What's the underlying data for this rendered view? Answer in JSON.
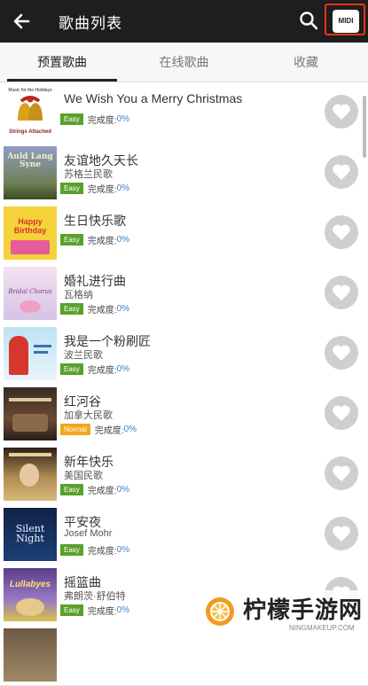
{
  "app_bar": {
    "title": "歌曲列表",
    "midi_label": "MIDI",
    "highlight_color": "#e8341c"
  },
  "tabs": [
    {
      "label": "预置歌曲",
      "active": true
    },
    {
      "label": "在线歌曲",
      "active": false
    },
    {
      "label": "收藏",
      "active": false
    }
  ],
  "songs": [
    {
      "title": "We Wish You a Merry Christmas",
      "artist": "",
      "level": "Easy",
      "done_label": "完成度:",
      "done_value": "0%",
      "cover_header": "Music for the Holidays",
      "cover_caption": "Strings Attached"
    },
    {
      "title": "友谊地久天长",
      "artist": "苏格兰民歌",
      "level": "Easy",
      "done_label": "完成度:",
      "done_value": "0%",
      "cover_header": "",
      "cover_caption": "Auld Lang Syne"
    },
    {
      "title": "生日快乐歌",
      "artist": "",
      "level": "Easy",
      "done_label": "完成度:",
      "done_value": "0%",
      "cover_header": "",
      "cover_caption": "Happy Birthday"
    },
    {
      "title": "婚礼进行曲",
      "artist": "瓦格纳",
      "level": "Easy",
      "done_label": "完成度:",
      "done_value": "0%",
      "cover_header": "",
      "cover_caption": "Bridal Chorus"
    },
    {
      "title": "我是一个粉刷匠",
      "artist": "波兰民歌",
      "level": "Easy",
      "done_label": "完成度:",
      "done_value": "0%",
      "cover_header": "",
      "cover_caption": ""
    },
    {
      "title": "红河谷",
      "artist": "加拿大民歌",
      "level": "Normal",
      "done_label": "完成度:",
      "done_value": "0%",
      "cover_header": "",
      "cover_caption": ""
    },
    {
      "title": "新年快乐",
      "artist": "美国民歌",
      "level": "Easy",
      "done_label": "完成度:",
      "done_value": "0%",
      "cover_header": "",
      "cover_caption": ""
    },
    {
      "title": "平安夜",
      "artist": "Josef Mohr",
      "level": "Easy",
      "done_label": "完成度:",
      "done_value": "0%",
      "cover_header": "",
      "cover_caption": "Silent Night"
    },
    {
      "title": "摇篮曲",
      "artist": "弗朗茨·舒伯特",
      "level": "Easy",
      "done_label": "完成度:",
      "done_value": "0%",
      "cover_header": "",
      "cover_caption": "Lullabyes"
    },
    {
      "title": "",
      "artist": "",
      "level": "",
      "done_label": "",
      "done_value": "",
      "cover_header": "",
      "cover_caption": ""
    }
  ],
  "watermark": {
    "text": "柠檬手游网",
    "sub": "NINGMAKEUP.COM"
  }
}
